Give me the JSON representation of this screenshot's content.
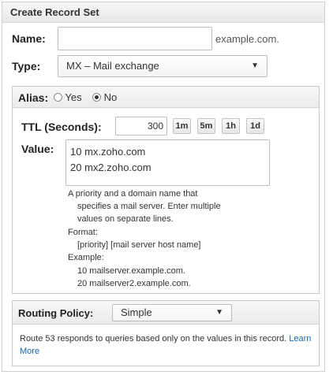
{
  "panel": {
    "title": "Create Record Set"
  },
  "name": {
    "label": "Name:",
    "value": "",
    "suffix": "example.com."
  },
  "type": {
    "label": "Type:",
    "selected": "MX – Mail exchange"
  },
  "alias": {
    "label": "Alias:",
    "yes": "Yes",
    "no": "No",
    "selected": "No"
  },
  "ttl": {
    "label": "TTL (Seconds):",
    "value": "300",
    "buttons": [
      "1m",
      "5m",
      "1h",
      "1d"
    ]
  },
  "value": {
    "label": "Value:",
    "text": "10 mx.zoho.com\n20 mx2.zoho.com",
    "help": {
      "line1": "A priority and a domain name that",
      "line2": "specifies a mail server. Enter multiple",
      "line3": "values on separate lines.",
      "format_label": "Format:",
      "format_value": "[priority] [mail server host name]",
      "example_label": "Example:",
      "example1": "10 mailserver.example.com.",
      "example2": "20 mailserver2.example.com."
    }
  },
  "routing": {
    "label": "Routing Policy:",
    "selected": "Simple",
    "description": "Route 53 responds to queries based only on the values in this record.",
    "learn_more": "Learn More"
  }
}
